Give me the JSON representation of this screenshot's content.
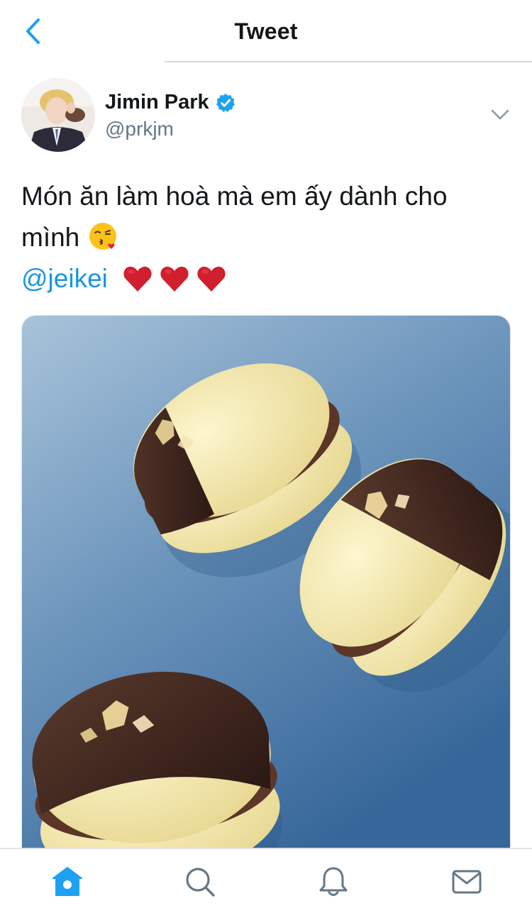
{
  "screen": {
    "title": "Tweet"
  },
  "tweet": {
    "author_name": "Jimin Park",
    "author_handle": "@prkjm",
    "verified": true,
    "text_line1": "Món ăn làm hoà mà em ấy dành cho",
    "text_line2": "mình",
    "mention": "@jeikei",
    "emoji": [
      "face-throwing-a-kiss",
      "red-heart",
      "red-heart",
      "red-heart"
    ],
    "media": {
      "type": "photo"
    }
  },
  "tabbar": {
    "items": [
      "home-icon",
      "search-icon",
      "notifications-icon",
      "messages-icon"
    ],
    "active": "home-icon"
  },
  "colors": {
    "accent": "#1da1f2",
    "mention": "#1b95e0",
    "text": "#14171a",
    "secondary": "#657786",
    "divider": "#d6d9dc"
  }
}
